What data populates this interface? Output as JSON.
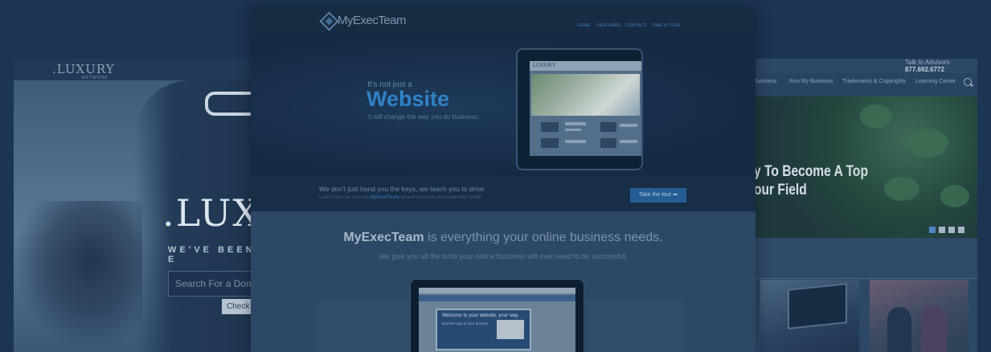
{
  "left_card": {
    "logo": ".LUXURY",
    "logo_sub": "NETWORK",
    "big_text": ".LUX",
    "tagline": "WE'VE BEEN E",
    "search_placeholder": "Search For a Dom",
    "check_button": "Check A"
  },
  "right_card": {
    "phone_label": "Talk to Advisors",
    "phone_number": "877.692.6772",
    "nav": [
      "Business",
      "Run My Business",
      "Trademarks & Copyrights",
      "Learning Center"
    ],
    "hero_title_line1": "y To Become A Top",
    "hero_title_line2": "our Field"
  },
  "center_card": {
    "logo": "MyExecTeam",
    "nav": [
      "HOME",
      "FEATURES",
      "CONTACT",
      "TAKE A TOUR"
    ],
    "kicker": "It's not just a",
    "headline": "Website",
    "subhead": "It will change the way you do business.",
    "tablet_brand": "LUXURY",
    "band_main": "We don't just hand you the keys, we teach you to drive.",
    "band_small_prefix": "Learn how you can use",
    "band_small_brand": "MyExecTeam",
    "band_small_suffix": "as a resource in your Learning Center.",
    "tour_button": "Take the tour",
    "lower_title_brand": "MyExecTeam",
    "lower_title_rest": " is everything your online business needs.",
    "lower_sub": "We give you all the tools your online business will ever need to be successful.",
    "laptop_panel_title": "Welcome to your website, your way.",
    "laptop_panel_sub": "Built the way of your dreams."
  },
  "colors": {
    "overlay_base": "#1c3553",
    "accent_blue": "#2f82c6",
    "button_blue": "#245d94"
  }
}
